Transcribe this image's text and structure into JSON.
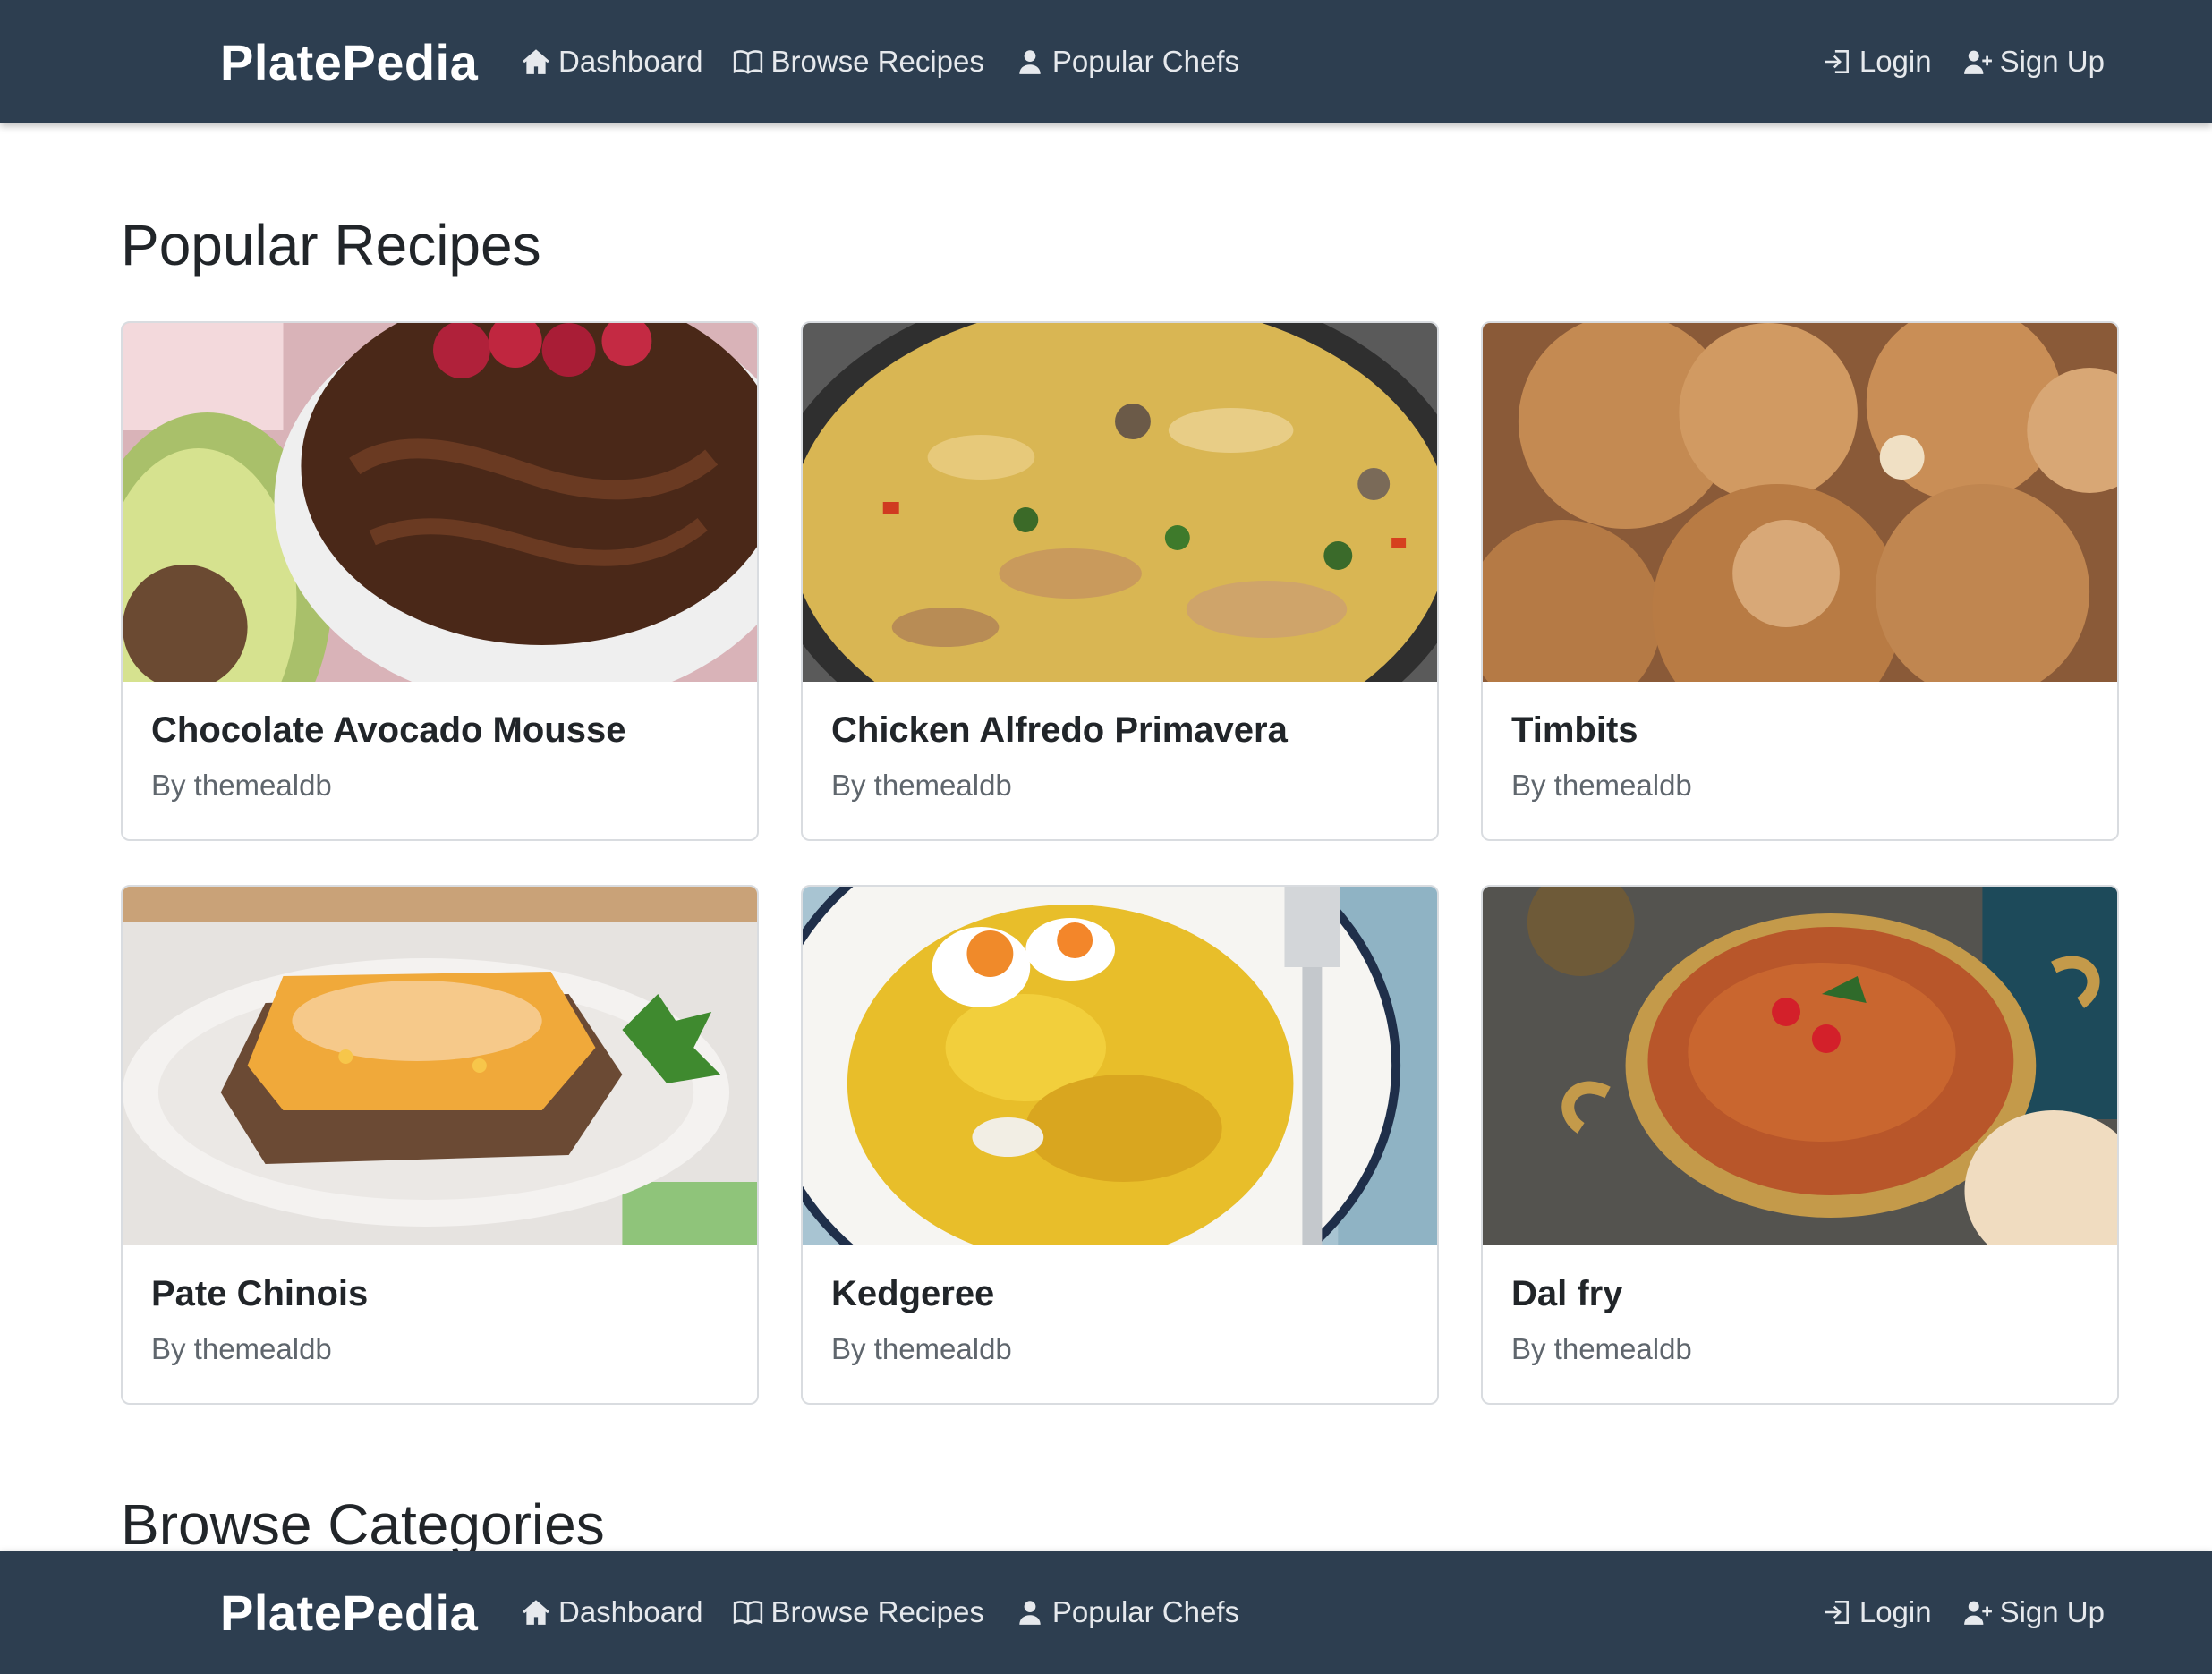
{
  "brand": "PlatePedia",
  "nav": {
    "links": [
      {
        "label": "Dashboard",
        "icon": "home-icon"
      },
      {
        "label": "Browse Recipes",
        "icon": "book-icon"
      },
      {
        "label": "Popular Chefs",
        "icon": "person-icon"
      }
    ],
    "auth": [
      {
        "label": "Login",
        "icon": "login-icon"
      },
      {
        "label": "Sign Up",
        "icon": "person-add-icon"
      }
    ]
  },
  "popular": {
    "title": "Popular Recipes",
    "recipes": [
      {
        "name": "Chocolate Avocado Mousse",
        "author": "By themealdb"
      },
      {
        "name": "Chicken Alfredo Primavera",
        "author": "By themealdb"
      },
      {
        "name": "Timbits",
        "author": "By themealdb"
      },
      {
        "name": "Pate Chinois",
        "author": "By themealdb"
      },
      {
        "name": "Kedgeree",
        "author": "By themealdb"
      },
      {
        "name": "Dal fry",
        "author": "By themealdb"
      }
    ]
  },
  "categories": {
    "title": "Browse Categories"
  },
  "colors": {
    "navbar": "#2d3e50",
    "nav_text": "#e6e9ed",
    "card_border": "#d9dce0",
    "subtext": "#5f666d"
  }
}
